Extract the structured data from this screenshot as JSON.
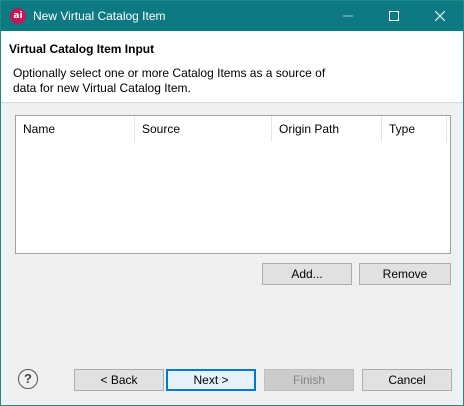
{
  "window": {
    "title": "New Virtual Catalog Item",
    "app_icon_text": "ai"
  },
  "header": {
    "title": "Virtual Catalog Item Input",
    "description": "Optionally select one or more Catalog Items as a source of data for new Virtual Catalog Item."
  },
  "table": {
    "columns": [
      "Name",
      "Source",
      "Origin Path",
      "Type"
    ],
    "rows": []
  },
  "actions": {
    "add_label": "Add...",
    "remove_label": "Remove"
  },
  "footer": {
    "help_symbol": "?",
    "back_label": "< Back",
    "next_label": "Next >",
    "finish_label": "Finish",
    "cancel_label": "Cancel"
  },
  "colors": {
    "titlebar": "#0d7a83",
    "app_icon": "#c2185b",
    "default_button_border": "#0078d7"
  },
  "icons": {
    "minimize": "minimize-icon",
    "maximize": "maximize-icon",
    "close": "close-icon",
    "help": "help-icon"
  }
}
